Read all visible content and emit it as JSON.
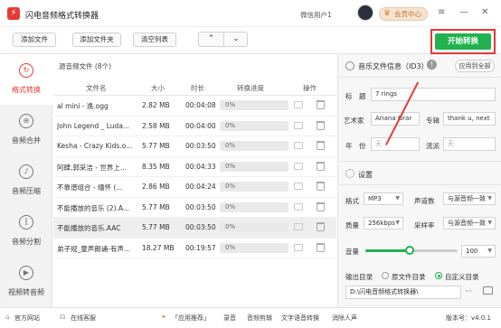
{
  "app": {
    "title": "闪电音频格式转换器",
    "user": "微信用户1",
    "member": "会员中心"
  },
  "toolbar": {
    "add_file": "添加文件",
    "add_folder": "添加文件夹",
    "clear": "清空列表",
    "up": "⌃",
    "down": "⌄",
    "start": "开始转换"
  },
  "sidebar": [
    {
      "label": "格式转换",
      "icon": "convert-icon",
      "glyph": "↻",
      "active": true
    },
    {
      "label": "音频合并",
      "icon": "merge-icon",
      "glyph": "⊕",
      "active": false
    },
    {
      "label": "音频压缩",
      "icon": "compress-icon",
      "glyph": "♪",
      "active": false
    },
    {
      "label": "音频分割",
      "icon": "split-icon",
      "glyph": "⫿",
      "active": false
    },
    {
      "label": "视频转音频",
      "icon": "video-icon",
      "glyph": "▶",
      "active": false
    }
  ],
  "files": {
    "header": "源音频文件 (8个)",
    "columns": [
      "文件名",
      "大小",
      "时长",
      "转换进度",
      "操作"
    ],
    "rows": [
      {
        "name": "al mini - 逸.ogg",
        "size": "2.82 MB",
        "duration": "00:04:08",
        "progress": "0%"
      },
      {
        "name": "John Legend _ Luda...",
        "size": "2.58 MB",
        "duration": "00:04:00",
        "progress": "0%"
      },
      {
        "name": "Kesha - Crazy Kids.o...",
        "size": "5.77 MB",
        "duration": "00:03:50",
        "progress": "0%"
      },
      {
        "name": "阿肆,郭采洁 - 世界上...",
        "size": "8.35 MB",
        "duration": "00:04:33",
        "progress": "0%"
      },
      {
        "name": "不靠谱组合 - 缅怀 (...",
        "size": "2.86 MB",
        "duration": "00:04:24",
        "progress": "0%"
      },
      {
        "name": "不能播放的音乐 (2).A...",
        "size": "5.77 MB",
        "duration": "00:03:50",
        "progress": "0%"
      },
      {
        "name": "不能播放的音乐.AAC",
        "size": "5.77 MB",
        "duration": "00:03:50",
        "progress": "0%"
      },
      {
        "name": "弟子规_童声朗诵-有声...",
        "size": "18.27 MB",
        "duration": "00:19:57",
        "progress": "0%"
      }
    ]
  },
  "info": {
    "title": "音乐文件信息（ID3）",
    "apply_all": "应用到全部",
    "title_label": "标　题",
    "title_value": "7 rings",
    "artist_label": "艺术家",
    "artist_value": "Ariana Grar",
    "album_label": "专辑",
    "album_value": "thank u, next",
    "year_label": "年　份",
    "year_value": "无",
    "genre_label": "流派",
    "genre_value": "无"
  },
  "settings": {
    "title": "设置",
    "format_label": "格式",
    "format_value": "MP3",
    "channels_label": "声道数",
    "channels_value": "与源音频一致",
    "quality_label": "质量",
    "quality_value": "256kbps",
    "samplerate_label": "采样率",
    "samplerate_value": "与源音频一致",
    "volume_label": "音量",
    "volume_value": "100",
    "volume_fraction": 0.48,
    "output_label": "输出目录",
    "opt_source": "原文件目录",
    "opt_custom": "自定义目录",
    "output_path": "D:\\闪电音频格式转换器\\",
    "browse": "···"
  },
  "status": {
    "website": "官方网站",
    "support": "在线客服",
    "recommend": "「应用推荐」",
    "rec": "录音",
    "edit": "音频剪辑",
    "t2s": "文字语音转换",
    "vocal": "消除人声",
    "version": "版本号：v4.0.1"
  },
  "colors": {
    "accent": "#e53935",
    "green": "#21b24f"
  }
}
